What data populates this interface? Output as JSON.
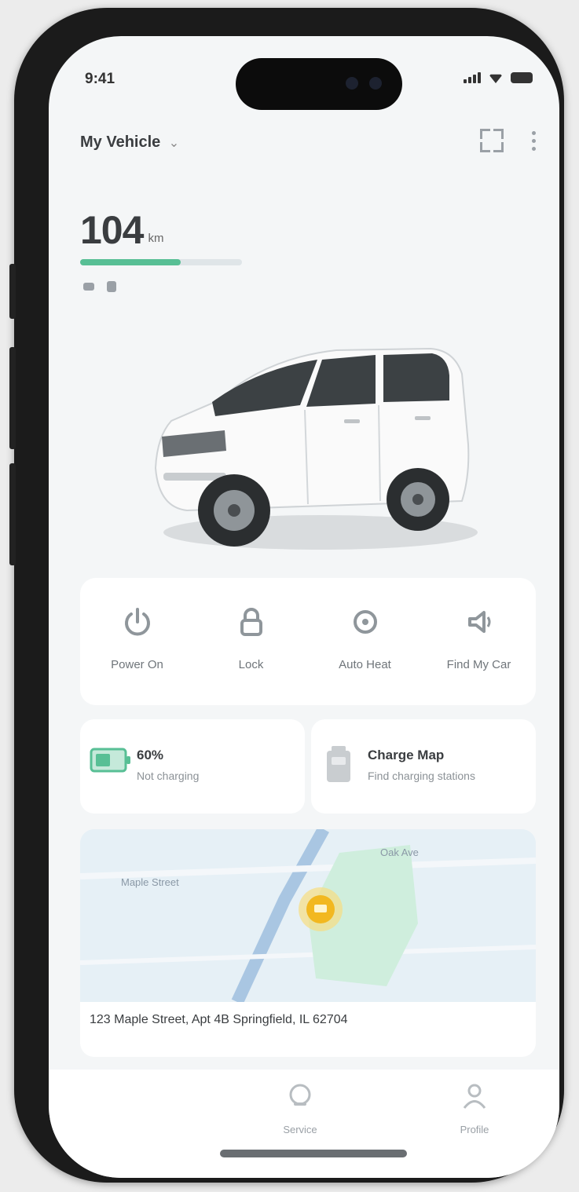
{
  "status_bar": {
    "time": "9:41"
  },
  "header": {
    "title": "My Vehicle",
    "chevron": "⌄"
  },
  "range": {
    "value": "104",
    "unit": "km",
    "level": 0.62
  },
  "quick_actions": [
    {
      "label": "Power On",
      "icon": "power-icon"
    },
    {
      "label": "Lock",
      "icon": "lock-icon"
    },
    {
      "label": "Auto Heat",
      "icon": "gear-icon"
    },
    {
      "label": "Find My Car",
      "icon": "horn-icon"
    }
  ],
  "info_cards": {
    "battery": {
      "title": "60%",
      "subtitle": "Not charging",
      "accent": "#58bf95"
    },
    "charging": {
      "title": "Charge Map",
      "subtitle": "Find charging stations",
      "accent": "#9aa0a6"
    }
  },
  "map": {
    "label_left": "Maple Street",
    "label_right": "Oak Ave",
    "pin_color": "#f2b820",
    "address": "123 Maple Street, Apt 4B Springfield, IL 62704"
  },
  "tabbar": {
    "tabs": [
      {
        "label": "Service",
        "icon": "service-icon"
      },
      {
        "label": "Profile",
        "icon": "profile-icon"
      }
    ]
  }
}
